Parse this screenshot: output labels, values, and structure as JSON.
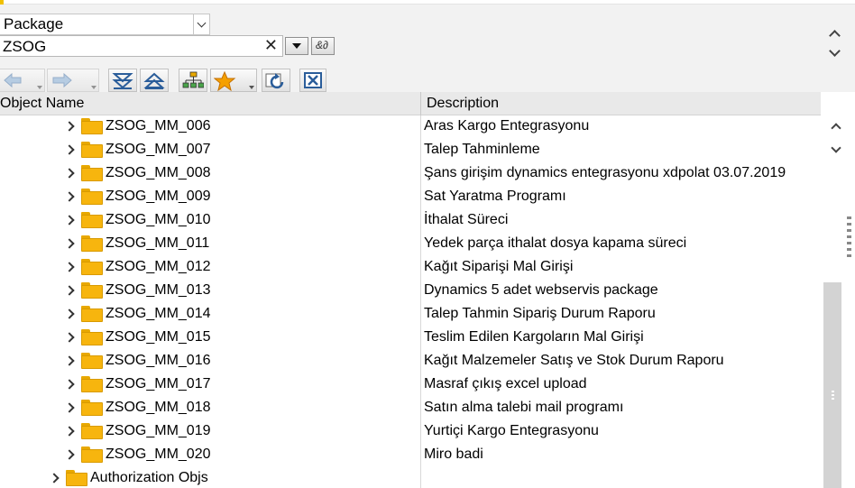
{
  "selector": {
    "object_type": "Package",
    "search_value": "ZSOG"
  },
  "toolbar": {
    "buttons": [
      {
        "icon": "back-arrow-icon"
      },
      {
        "icon": "forward-arrow-icon"
      },
      {
        "icon": "expand-all-icon"
      },
      {
        "icon": "collapse-all-icon"
      },
      {
        "icon": "hierarchy-icon"
      },
      {
        "icon": "favorites-star-icon"
      },
      {
        "icon": "refresh-icon"
      },
      {
        "icon": "close-window-icon"
      }
    ]
  },
  "columns": {
    "object_name": "Object Name",
    "description": "Description"
  },
  "rows": [
    {
      "name": "ZSOG_MM_006",
      "description": "Aras Kargo Entegrasyonu"
    },
    {
      "name": "ZSOG_MM_007",
      "description": "Talep Tahminleme"
    },
    {
      "name": "ZSOG_MM_008",
      "description": "Şans girişim dynamics entegrasyonu xdpolat 03.07.2019"
    },
    {
      "name": "ZSOG_MM_009",
      "description": "Sat Yaratma Programı"
    },
    {
      "name": "ZSOG_MM_010",
      "description": "İthalat Süreci"
    },
    {
      "name": "ZSOG_MM_011",
      "description": "Yedek parça ithalat dosya kapama süreci"
    },
    {
      "name": "ZSOG_MM_012",
      "description": "Kağıt Siparişi Mal Girişi"
    },
    {
      "name": "ZSOG_MM_013",
      "description": "Dynamics 5 adet webservis package"
    },
    {
      "name": "ZSOG_MM_014",
      "description": "Talep Tahmin Sipariş Durum Raporu"
    },
    {
      "name": "ZSOG_MM_015",
      "description": "Teslim Edilen Kargoların Mal Girişi"
    },
    {
      "name": "ZSOG_MM_016",
      "description": "Kağıt Malzemeler Satış ve Stok Durum Raporu"
    },
    {
      "name": "ZSOG_MM_017",
      "description": "Masraf çıkış excel upload"
    },
    {
      "name": "ZSOG_MM_018",
      "description": "Satın alma talebi mail programı"
    },
    {
      "name": "ZSOG_MM_019",
      "description": "Yurtiçi Kargo Entegrasyonu"
    },
    {
      "name": "ZSOG_MM_020",
      "description": "Miro badi"
    },
    {
      "name": "Authorization Objs",
      "description": ""
    }
  ],
  "colors": {
    "folder": "#f7b50e",
    "header_bg": "#e9e9e9",
    "toolbar_bg": "#f2f2f2"
  }
}
